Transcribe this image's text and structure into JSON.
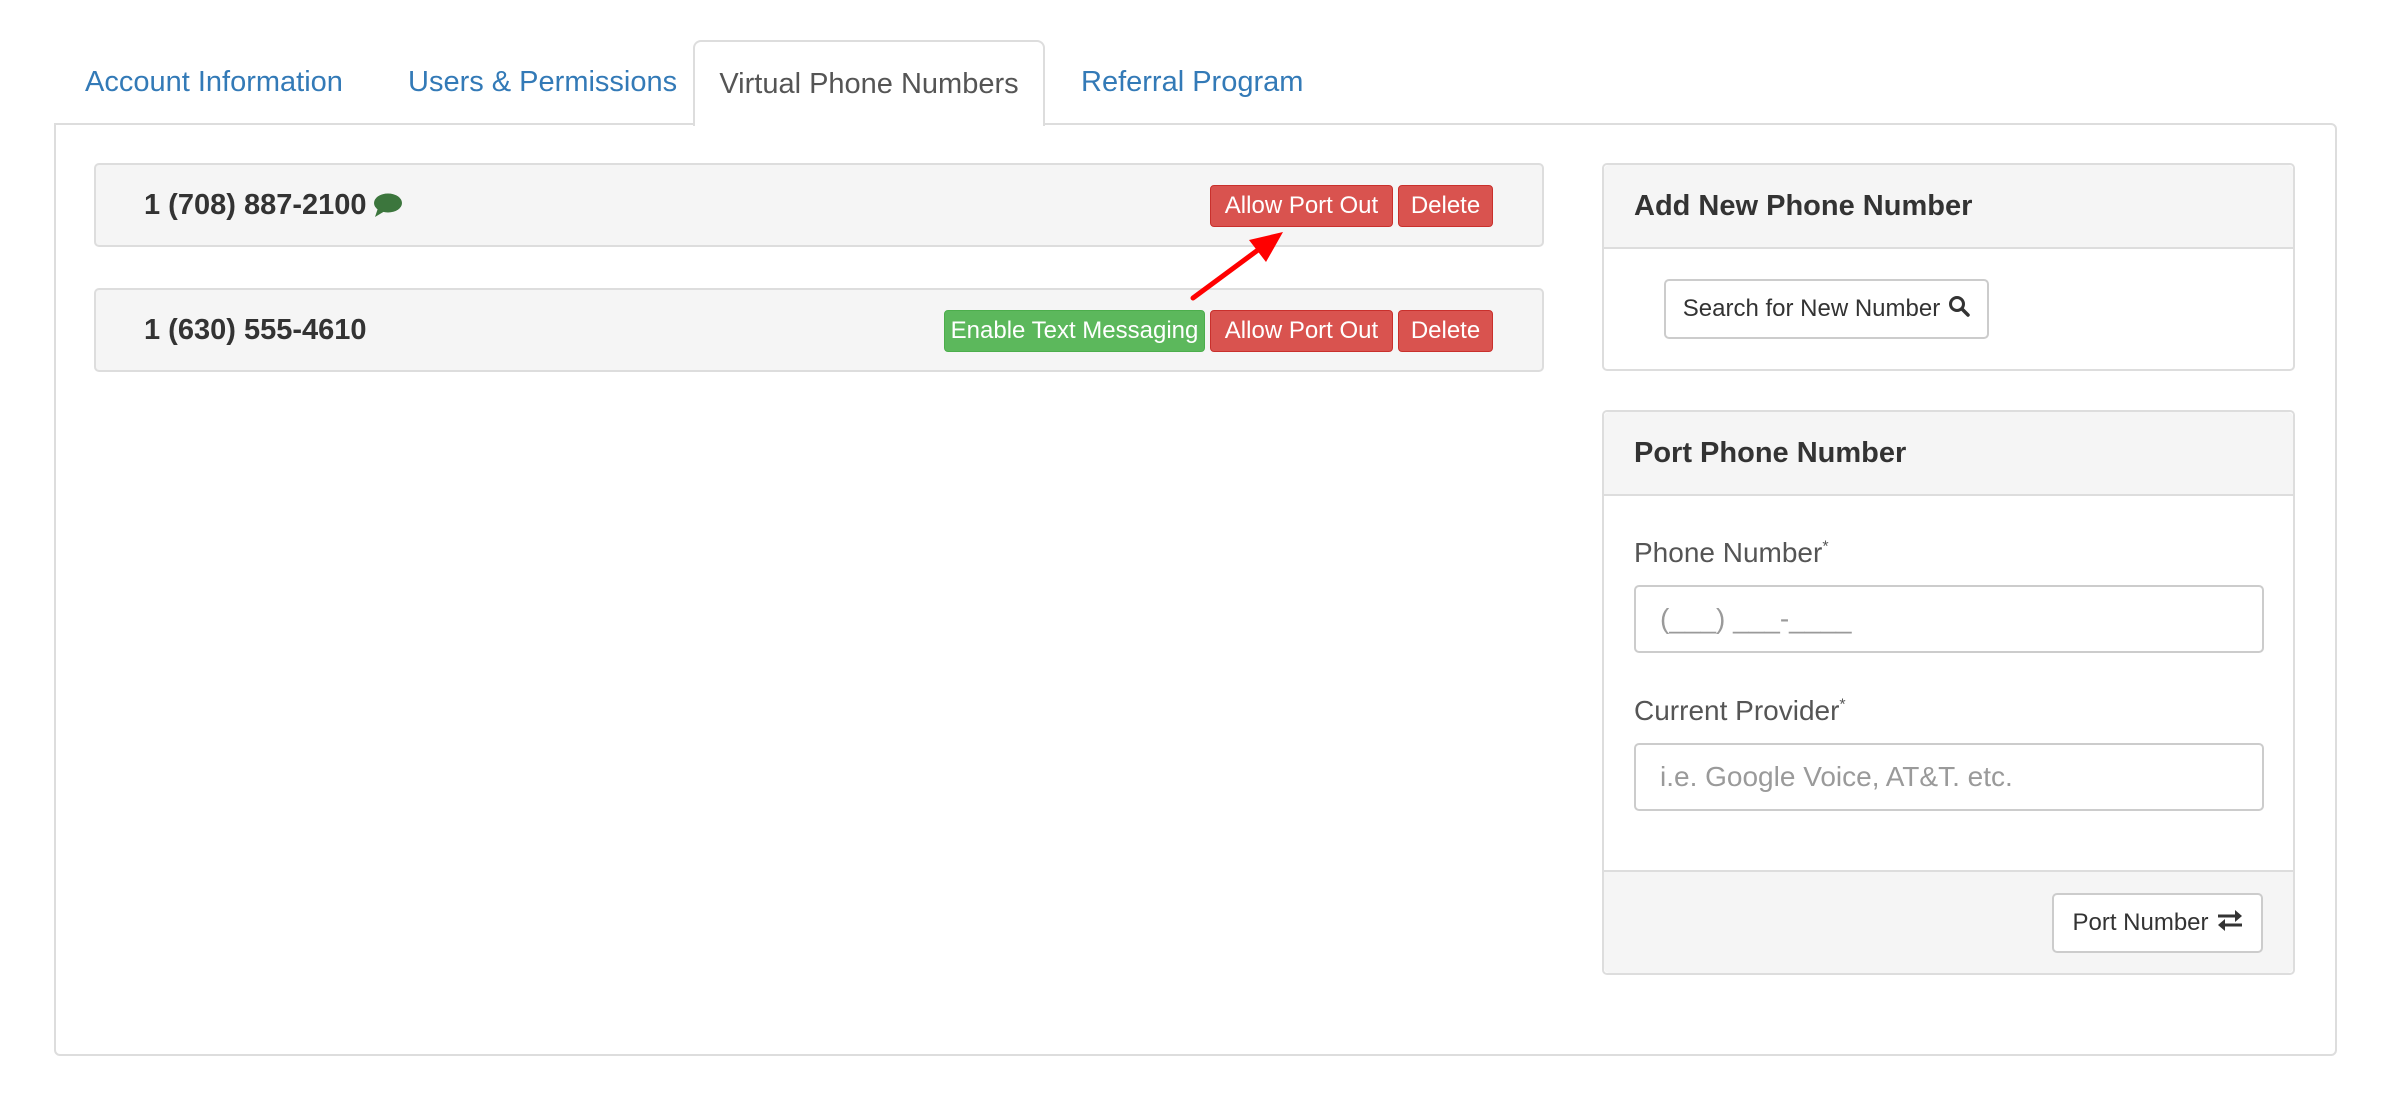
{
  "tabs": [
    {
      "label": "Account Information",
      "active": false
    },
    {
      "label": "Users & Permissions",
      "active": false
    },
    {
      "label": "Virtual Phone Numbers",
      "active": true
    },
    {
      "label": "Referral Program",
      "active": false
    }
  ],
  "phone_numbers": [
    {
      "number": "1 (708) 887-2100",
      "icon": "chat-bubble-icon",
      "buttons": {
        "allow_port_out": "Allow Port Out",
        "delete": "Delete"
      }
    },
    {
      "number": "1 (630) 555-4610",
      "buttons": {
        "enable_text_messaging": "Enable Text Messaging",
        "allow_port_out": "Allow Port Out",
        "delete": "Delete"
      }
    }
  ],
  "add_panel": {
    "title": "Add New Phone Number",
    "search_button": "Search for New Number",
    "search_icon": "search-icon"
  },
  "port_panel": {
    "title": "Port Phone Number",
    "phone_label": "Phone Number",
    "required_mark": "*",
    "phone_placeholder": "(___) ___-____",
    "provider_label": "Current Provider",
    "provider_placeholder": "i.e. Google Voice, AT&T. etc.",
    "port_button": "Port Number",
    "port_icon": "exchange-icon"
  },
  "colors": {
    "link": "#337ab7",
    "danger": "#d9534f",
    "success": "#5cb85c",
    "chat_icon": "#3c763d",
    "annotation_arrow": "#ff0000"
  }
}
